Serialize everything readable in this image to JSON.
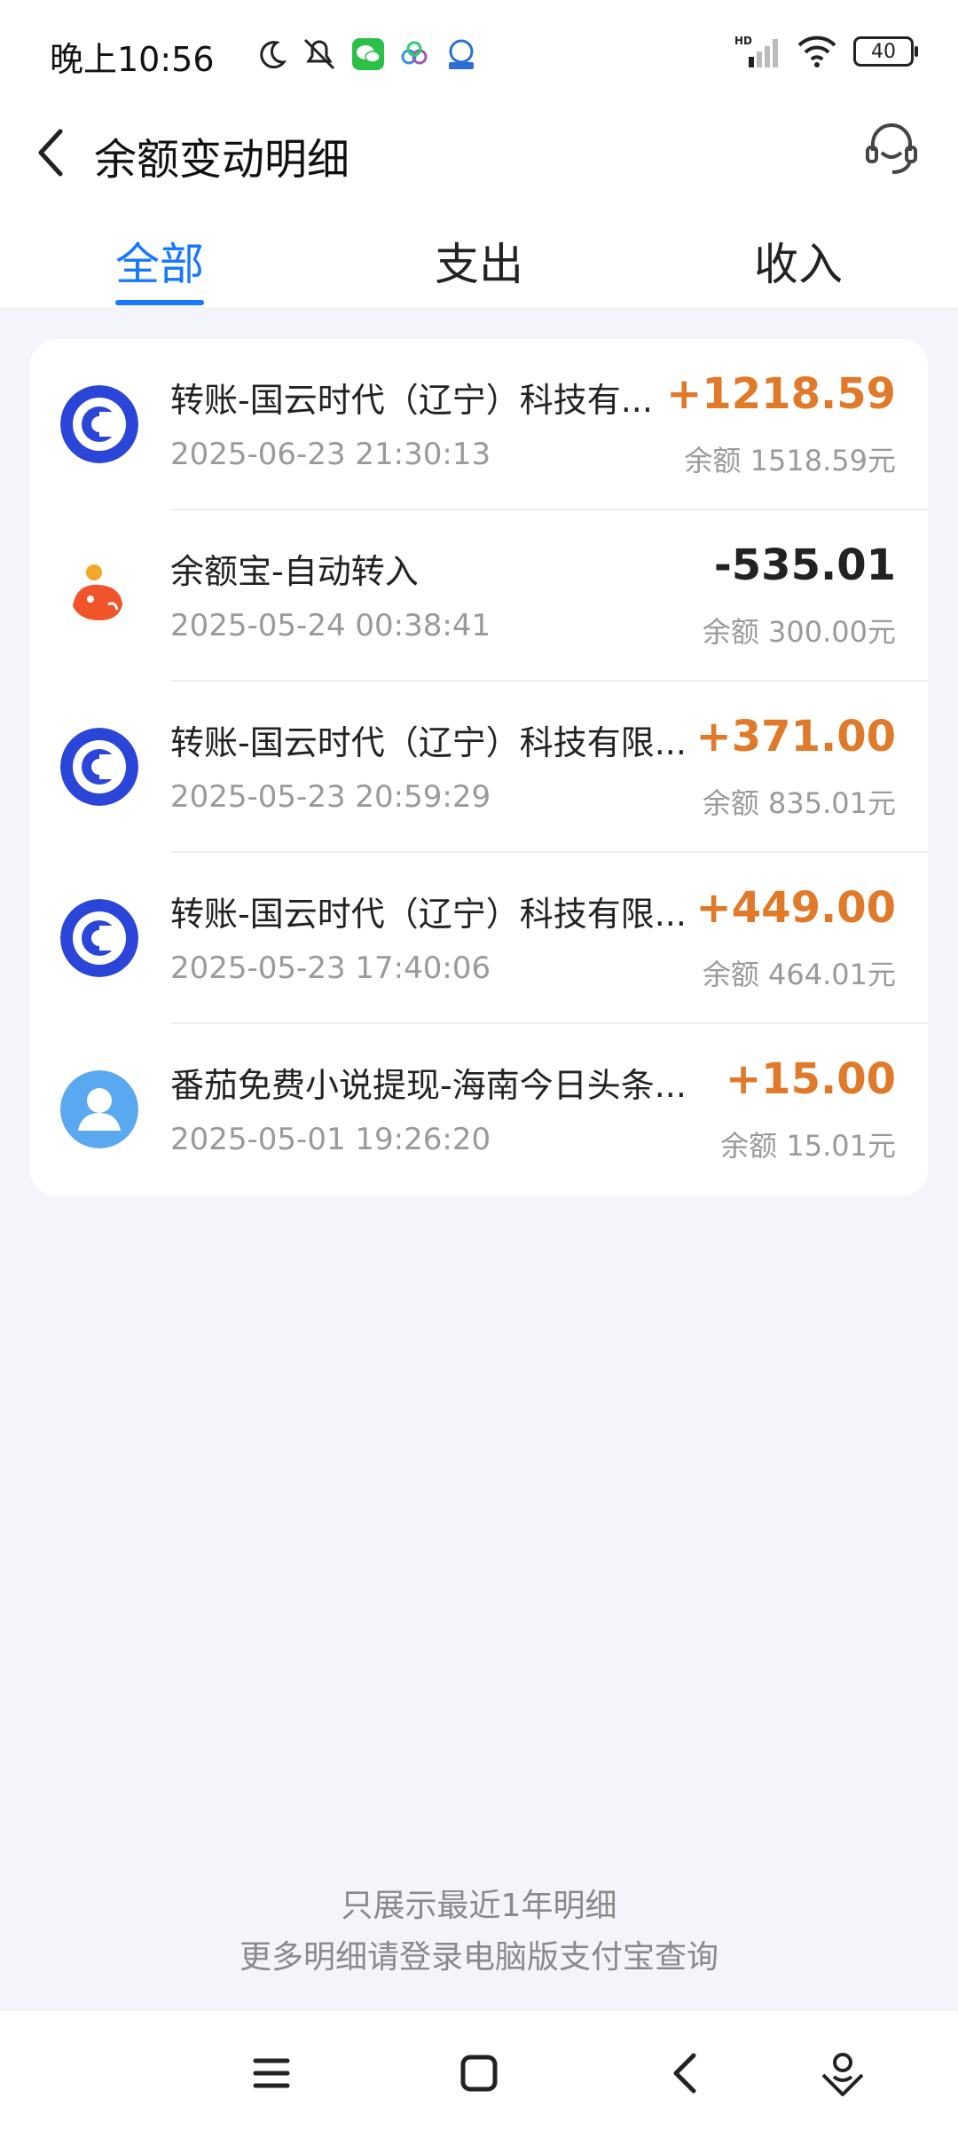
{
  "status": {
    "time": "晚上10:56",
    "network": "HD",
    "battery": "40"
  },
  "header": {
    "title": "余额变动明细"
  },
  "tabs": [
    {
      "label": "全部"
    },
    {
      "label": "支出"
    },
    {
      "label": "收入"
    }
  ],
  "transactions": [
    {
      "name": "转账-国云时代（辽宁）科技有...",
      "date": "2025-06-23 21:30:13",
      "amount": "+1218.59",
      "balance": "余额 1518.59元",
      "icon": "transfer-icon"
    },
    {
      "name": "余额宝-自动转入",
      "date": "2025-05-24 00:38:41",
      "amount": "-535.01",
      "balance": "余额 300.00元",
      "icon": "yuebao-icon"
    },
    {
      "name": "转账-国云时代（辽宁）科技有限...",
      "date": "2025-05-23 20:59:29",
      "amount": "+371.00",
      "balance": "余额 835.01元",
      "icon": "transfer-icon"
    },
    {
      "name": "转账-国云时代（辽宁）科技有限...",
      "date": "2025-05-23 17:40:06",
      "amount": "+449.00",
      "balance": "余额 464.01元",
      "icon": "transfer-icon"
    },
    {
      "name": "番茄免费小说提现-海南今日头条...",
      "date": "2025-05-01 19:26:20",
      "amount": "+15.00",
      "balance": "余额 15.01元",
      "icon": "user-icon"
    }
  ],
  "footer": {
    "line1": "只展示最近1年明细",
    "line2": "更多明细请登录电脑版支付宝查询"
  },
  "colors": {
    "accent": "#1677ff",
    "income": "#e07a2a"
  }
}
